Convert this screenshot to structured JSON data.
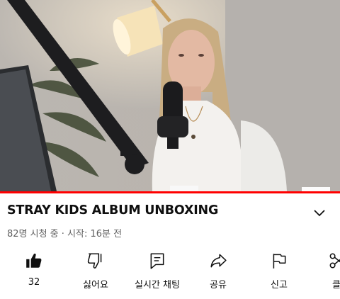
{
  "video": {
    "title": "STRAY KIDS ALBUM UNBOXING",
    "meta": "82명 시청 중 · 시작: 16분 전",
    "progress_fraction": 1.0
  },
  "actions": [
    {
      "icon": "thumbs-up-filled-icon",
      "label": "32"
    },
    {
      "icon": "thumbs-down-icon",
      "label": "싫어요"
    },
    {
      "icon": "live-chat-icon",
      "label": "실시간 채팅"
    },
    {
      "icon": "share-icon",
      "label": "공유"
    },
    {
      "icon": "flag-icon",
      "label": "신고"
    },
    {
      "icon": "clip-icon",
      "label": "클"
    }
  ],
  "colors": {
    "progress": "#ff0000",
    "text_primary": "#0f0f0f",
    "text_secondary": "#606060"
  }
}
